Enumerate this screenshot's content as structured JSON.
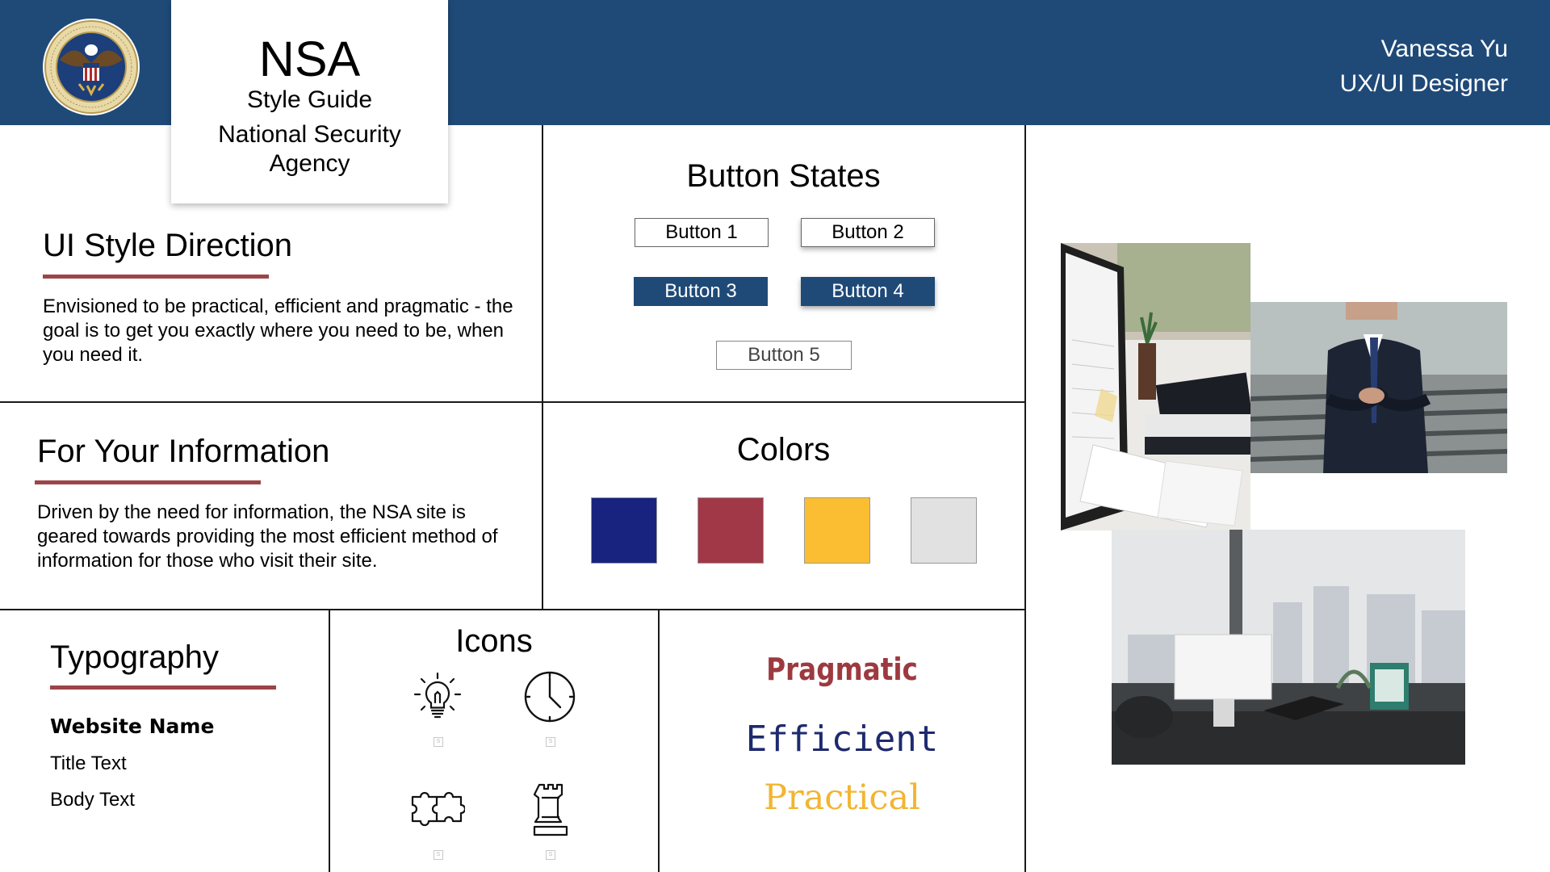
{
  "header": {
    "designer_name": "Vanessa Yu",
    "designer_role": "UX/UI Designer",
    "bg_color": "#1f4a78",
    "seal_icon": "nsa-seal-icon",
    "seal_text": "NATIONAL SECURITY AGENCY · UNITED STATES OF AMERICA"
  },
  "title_card": {
    "title": "NSA",
    "subtitle": "Style Guide",
    "org": "National Security Agency"
  },
  "ui_style": {
    "heading": "UI Style Direction",
    "body": "Envisioned to be practical, efficient and pragmatic - the goal is to get you exactly where you need to be, when you need it."
  },
  "fyi": {
    "heading": "For Your Information",
    "body": "Driven by the need for information, the NSA site is geared towards providing the most efficient method of information for those who visit their site."
  },
  "buttons": {
    "heading": "Button States",
    "b1": "Button 1",
    "b2": "Button 2",
    "b3": "Button 3",
    "b4": "Button 4",
    "b5": "Button 5"
  },
  "colors": {
    "heading": "Colors",
    "swatches": [
      "#17237f",
      "#a13847",
      "#fbbe32",
      "#e1e1e1"
    ]
  },
  "typography": {
    "heading": "Typography",
    "website_name": "Website Name",
    "title_text": "Title Text",
    "body_text": "Body Text"
  },
  "icons": {
    "heading": "Icons",
    "items": [
      "lightbulb-icon",
      "clock-icon",
      "puzzle-icon",
      "chess-rook-icon"
    ],
    "caption": "S"
  },
  "words": {
    "pragmatic": "Pragmatic",
    "efficient": "Efficient",
    "practical": "Practical",
    "pragmatic_color": "#9c3a40",
    "efficient_color": "#1e2a6e",
    "practical_color": "#f2b531"
  },
  "accent_rule_color": "#9c4548"
}
